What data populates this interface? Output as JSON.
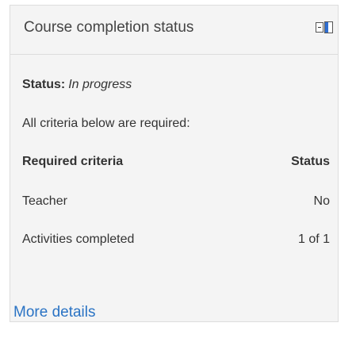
{
  "block": {
    "title": "Course completion status"
  },
  "status": {
    "label": "Status:",
    "value": "In progress"
  },
  "criteria_note": "All criteria below are required:",
  "table": {
    "headers": [
      "Required criteria",
      "Status"
    ],
    "rows": [
      [
        "Teacher",
        "No"
      ],
      [
        "Activities completed",
        "1 of 1"
      ]
    ]
  },
  "links": {
    "more_details": "More details"
  },
  "icons": {
    "dock": "dock-icon",
    "minimize": "minimize-icon"
  },
  "colors": {
    "link": "#2a73c4",
    "dock_accent": "#2f6fd2"
  }
}
